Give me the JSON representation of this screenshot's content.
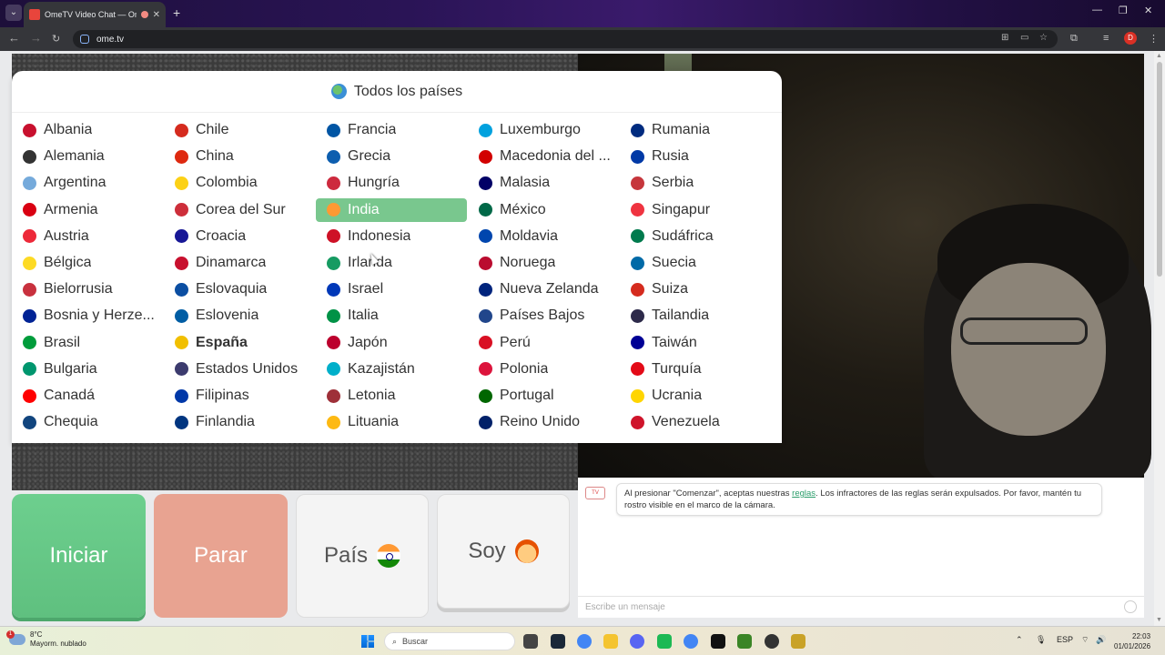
{
  "browser": {
    "tab_title": "OmeTV Video Chat — Ome",
    "tab_close": "✕",
    "new_tab": "+",
    "url": "ome.tv",
    "profile_initial": "D"
  },
  "dropdown": {
    "title": "Todos los países",
    "columns": [
      [
        {
          "name": "Albania",
          "flag": "#c8102e"
        },
        {
          "name": "Alemania",
          "flag": "#333333"
        },
        {
          "name": "Argentina",
          "flag": "#75aadb"
        },
        {
          "name": "Armenia",
          "flag": "#d90012"
        },
        {
          "name": "Austria",
          "flag": "#ed2939"
        },
        {
          "name": "Bélgica",
          "flag": "#fdda24"
        },
        {
          "name": "Bielorrusia",
          "flag": "#c8313e"
        },
        {
          "name": "Bosnia y Herze...",
          "flag": "#002395"
        },
        {
          "name": "Brasil",
          "flag": "#009c3b"
        },
        {
          "name": "Bulgaria",
          "flag": "#00966e"
        },
        {
          "name": "Canadá",
          "flag": "#ff0000"
        },
        {
          "name": "Chequia",
          "flag": "#11457e"
        }
      ],
      [
        {
          "name": "Chile",
          "flag": "#d52b1e"
        },
        {
          "name": "China",
          "flag": "#de2910"
        },
        {
          "name": "Colombia",
          "flag": "#fcd116"
        },
        {
          "name": "Corea del Sur",
          "flag": "#cd2e3a"
        },
        {
          "name": "Croacia",
          "flag": "#171796"
        },
        {
          "name": "Dinamarca",
          "flag": "#c8102e"
        },
        {
          "name": "Eslovaquia",
          "flag": "#0b4ea2"
        },
        {
          "name": "Eslovenia",
          "flag": "#005da4"
        },
        {
          "name": "España",
          "flag": "#f1bf00",
          "bold": true
        },
        {
          "name": "Estados Unidos",
          "flag": "#3c3b6e"
        },
        {
          "name": "Filipinas",
          "flag": "#0038a8"
        },
        {
          "name": "Finlandia",
          "flag": "#003580"
        }
      ],
      [
        {
          "name": "Francia",
          "flag": "#0055a4"
        },
        {
          "name": "Grecia",
          "flag": "#0d5eaf"
        },
        {
          "name": "Hungría",
          "flag": "#cd2a3e"
        },
        {
          "name": "India",
          "flag": "#ff9933",
          "active": true
        },
        {
          "name": "Indonesia",
          "flag": "#ce1126"
        },
        {
          "name": "Irlanda",
          "flag": "#169b62"
        },
        {
          "name": "Israel",
          "flag": "#0038b8"
        },
        {
          "name": "Italia",
          "flag": "#009246"
        },
        {
          "name": "Japón",
          "flag": "#bc002d"
        },
        {
          "name": "Kazajistán",
          "flag": "#00afca"
        },
        {
          "name": "Letonia",
          "flag": "#9e3039"
        },
        {
          "name": "Lituania",
          "flag": "#fdb913"
        }
      ],
      [
        {
          "name": "Luxemburgo",
          "flag": "#00a1de"
        },
        {
          "name": "Macedonia del ...",
          "flag": "#d20000"
        },
        {
          "name": "Malasia",
          "flag": "#010066"
        },
        {
          "name": "México",
          "flag": "#006847"
        },
        {
          "name": "Moldavia",
          "flag": "#0046ae"
        },
        {
          "name": "Noruega",
          "flag": "#ba0c2f"
        },
        {
          "name": "Nueva Zelanda",
          "flag": "#00247d"
        },
        {
          "name": "Países Bajos",
          "flag": "#21468b"
        },
        {
          "name": "Perú",
          "flag": "#d91023"
        },
        {
          "name": "Polonia",
          "flag": "#dc143c"
        },
        {
          "name": "Portugal",
          "flag": "#006600"
        },
        {
          "name": "Reino Unido",
          "flag": "#012169"
        }
      ],
      [
        {
          "name": "Rumania",
          "flag": "#002b7f"
        },
        {
          "name": "Rusia",
          "flag": "#0039a6"
        },
        {
          "name": "Serbia",
          "flag": "#c6363c"
        },
        {
          "name": "Singapur",
          "flag": "#ef3340"
        },
        {
          "name": "Sudáfrica",
          "flag": "#007a4d"
        },
        {
          "name": "Suecia",
          "flag": "#006aa7"
        },
        {
          "name": "Suiza",
          "flag": "#d52b1e"
        },
        {
          "name": "Tailandia",
          "flag": "#2d2a4a"
        },
        {
          "name": "Taiwán",
          "flag": "#000095"
        },
        {
          "name": "Turquía",
          "flag": "#e30a17"
        },
        {
          "name": "Ucrania",
          "flag": "#ffd500"
        },
        {
          "name": "Venezuela",
          "flag": "#cf142b"
        }
      ]
    ]
  },
  "controls": {
    "start": "Iniciar",
    "stop": "Parar",
    "country": "País",
    "gender": "Soy"
  },
  "chat": {
    "logo": "TV",
    "message_pre": "Al presionar \"Comenzar\", aceptas nuestras ",
    "message_link": "reglas",
    "message_post": ". Los infractores de las reglas serán expulsados. Por favor, mantén tu rostro visible en el marco de la cámara.",
    "input_placeholder": "Escribe un mensaje"
  },
  "taskbar": {
    "weather_temp": "8°C",
    "weather_desc": "Mayorm. nublado",
    "weather_badge": "1",
    "search_label": "Buscar",
    "lang": "ESP",
    "time": "22:03",
    "date": "01/01/2026"
  }
}
